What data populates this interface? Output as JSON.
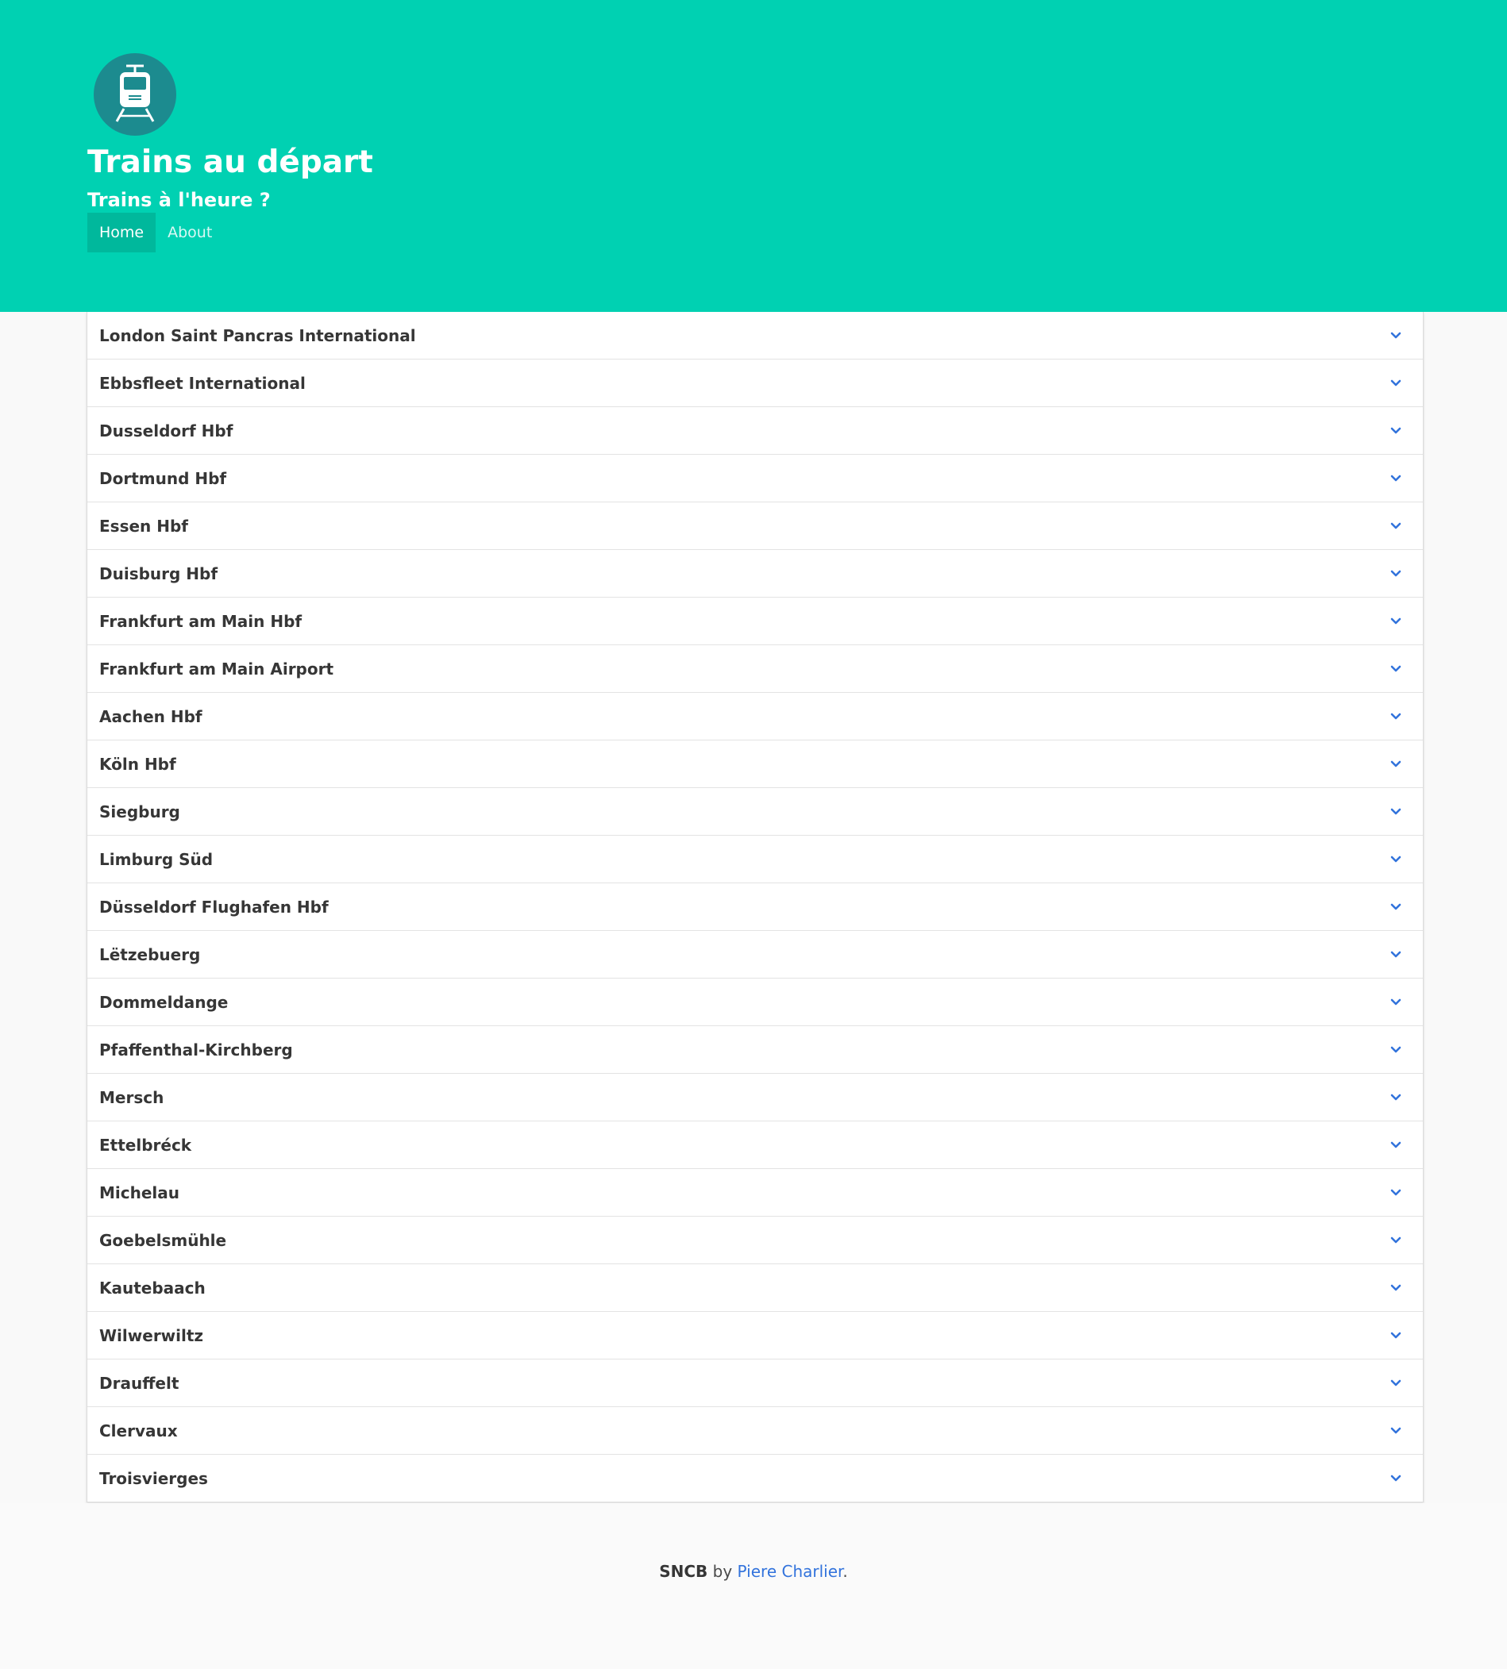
{
  "header": {
    "logo_icon": "train-icon",
    "title": "Trains au départ",
    "subtitle": "Trains à l'heure ?",
    "tabs": [
      {
        "label": "Home",
        "active": true
      },
      {
        "label": "About",
        "active": false
      }
    ]
  },
  "stations": [
    "London Saint Pancras International",
    "Ebbsfleet International",
    "Dusseldorf Hbf",
    "Dortmund Hbf",
    "Essen Hbf",
    "Duisburg Hbf",
    "Frankfurt am Main Hbf",
    "Frankfurt am Main Airport",
    "Aachen Hbf",
    "Köln Hbf",
    "Siegburg",
    "Limburg Süd",
    "Düsseldorf Flughafen Hbf",
    "Lëtzebuerg",
    "Dommeldange",
    "Pfaffenthal-Kirchberg",
    "Mersch",
    "Ettelbréck",
    "Michelau",
    "Goebelsmühle",
    "Kautebaach",
    "Wilwerwiltz",
    "Drauffelt",
    "Clervaux",
    "Troisvierges"
  ],
  "footer": {
    "brand": "SNCB",
    "by": " by ",
    "author": "Piere Charlier",
    "end": "."
  },
  "colors": {
    "hero": "#00d1b2",
    "active_tab": "#00b89c",
    "logo_circle": "#1c8b8f",
    "chevron": "#3273dc",
    "link": "#3273dc"
  }
}
